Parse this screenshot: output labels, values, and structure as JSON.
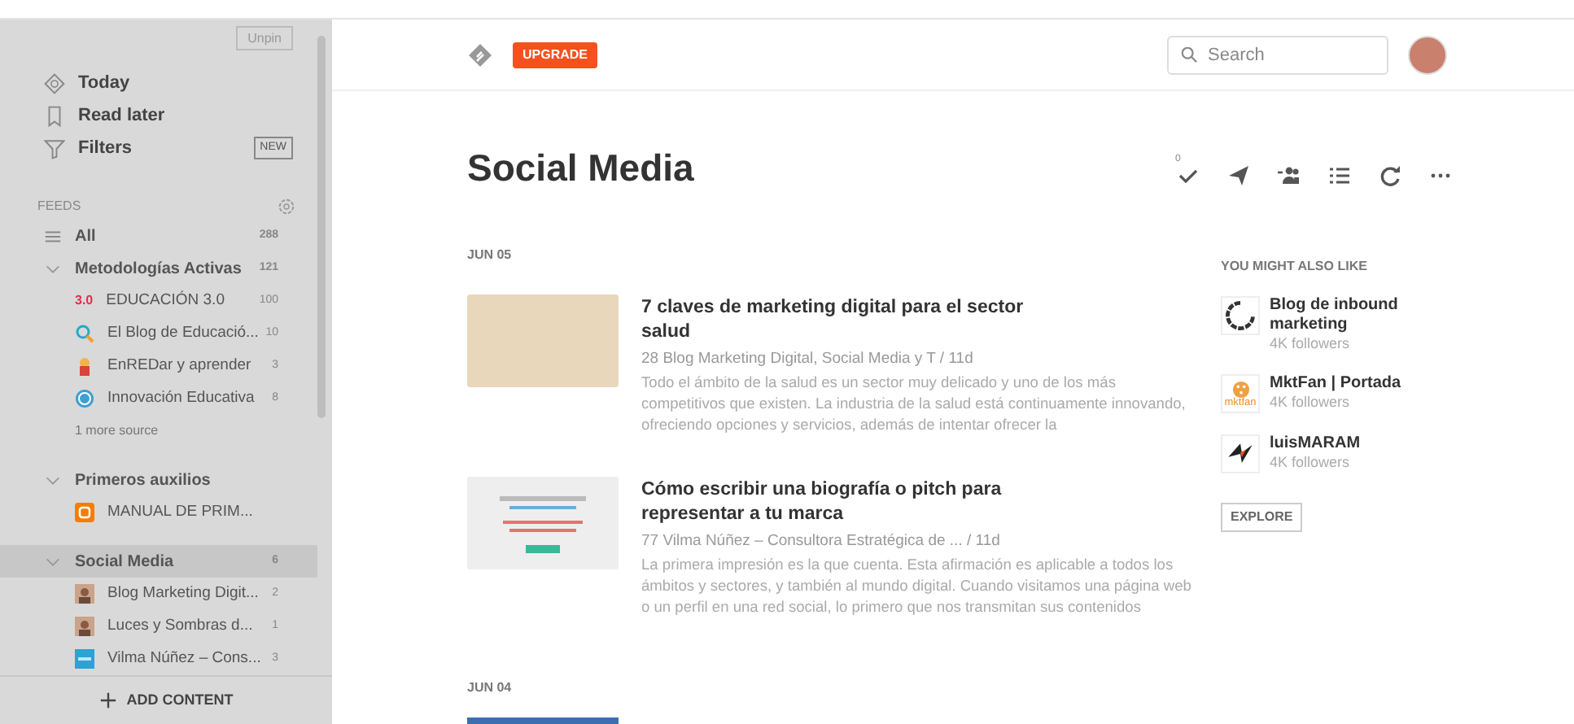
{
  "sidebar": {
    "unpin": "Unpin",
    "nav": [
      {
        "kind": "today",
        "label": "Today"
      },
      {
        "kind": "bookmark",
        "label": "Read later"
      },
      {
        "kind": "filter",
        "label": "Filters",
        "badge": "NEW"
      }
    ],
    "feeds_title": "FEEDS",
    "all": {
      "label": "All",
      "count": "288",
      "selected": false
    },
    "folders": [
      {
        "label": "Metodologías Activas",
        "count": "121",
        "expanded": true,
        "selected": false,
        "children": [
          {
            "kind": "text",
            "icon_text": "3.0",
            "label": "EDUCACIÓN 3.0",
            "count": "100"
          },
          {
            "kind": "magnifier",
            "label": "El Blog de Educació...",
            "count": "10"
          },
          {
            "kind": "cartoon",
            "label": "EnREDar y aprender",
            "count": "3"
          },
          {
            "kind": "wordpress",
            "label": "Innovación Educativa",
            "count": "8"
          }
        ],
        "more": "1 more source"
      },
      {
        "label": "Primeros auxilios",
        "expanded": true,
        "selected": false,
        "children": [
          {
            "kind": "blogger",
            "label": "MANUAL DE PRIM..."
          }
        ]
      },
      {
        "label": "Social Media",
        "count": "6",
        "expanded": true,
        "selected": true,
        "children": [
          {
            "kind": "person",
            "label": "Blog Marketing Digit...",
            "count": "2"
          },
          {
            "kind": "person",
            "label": "Luces y Sombras d...",
            "count": "1"
          },
          {
            "kind": "square",
            "label": "Vilma Núñez – Cons...",
            "count": "3"
          }
        ]
      }
    ],
    "add_content": "ADD CONTENT"
  },
  "header": {
    "upgrade": "UPGRADE",
    "search": {
      "placeholder": "Search"
    }
  },
  "title": "Social Media",
  "toolbar": {
    "unread_count": "0"
  },
  "sections": [
    {
      "date": "JUN 05",
      "articles": [
        {
          "kind": "photo",
          "title": "7 claves de marketing digital para el sector salud",
          "engagement": "28",
          "source": "Blog Marketing Digital, Social Media y T",
          "age": "/ 11d",
          "snippet": "Todo el ámbito de la salud es un sector muy delicado y uno de los más competitivos que existen. La industria de la salud está continuamente innovando, ofreciendo opciones y servicios, además de intentar ofrecer la"
        },
        {
          "kind": "webpage",
          "title": "Cómo escribir una biografía o pitch para representar a tu marca",
          "engagement": "77",
          "source": "Vilma Núñez – Consultora Estratégica de ...",
          "age": "/ 11d",
          "snippet": "La primera impresión es la que cuenta. Esta afirmación es aplicable a todos los ámbitos y sectores, y también al mundo digital. Cuando visitamos una página web o un perfil en una red social, lo primero que nos transmitan sus contenidos"
        }
      ]
    },
    {
      "date": "JUN 04",
      "cut_thumbnail": true
    }
  ],
  "suggestions": {
    "title": "YOU MIGHT ALSO LIKE",
    "items": [
      {
        "kind": "ring",
        "name": "Blog de inbound marketing",
        "followers": "4K followers"
      },
      {
        "kind": "mktfan",
        "logo_text": "mktfan",
        "name": "MktFan | Portada",
        "followers": "4K followers"
      },
      {
        "kind": "bolt",
        "name": "luisMARAM",
        "followers": "4K followers"
      }
    ],
    "explore": "EXPLORE"
  }
}
